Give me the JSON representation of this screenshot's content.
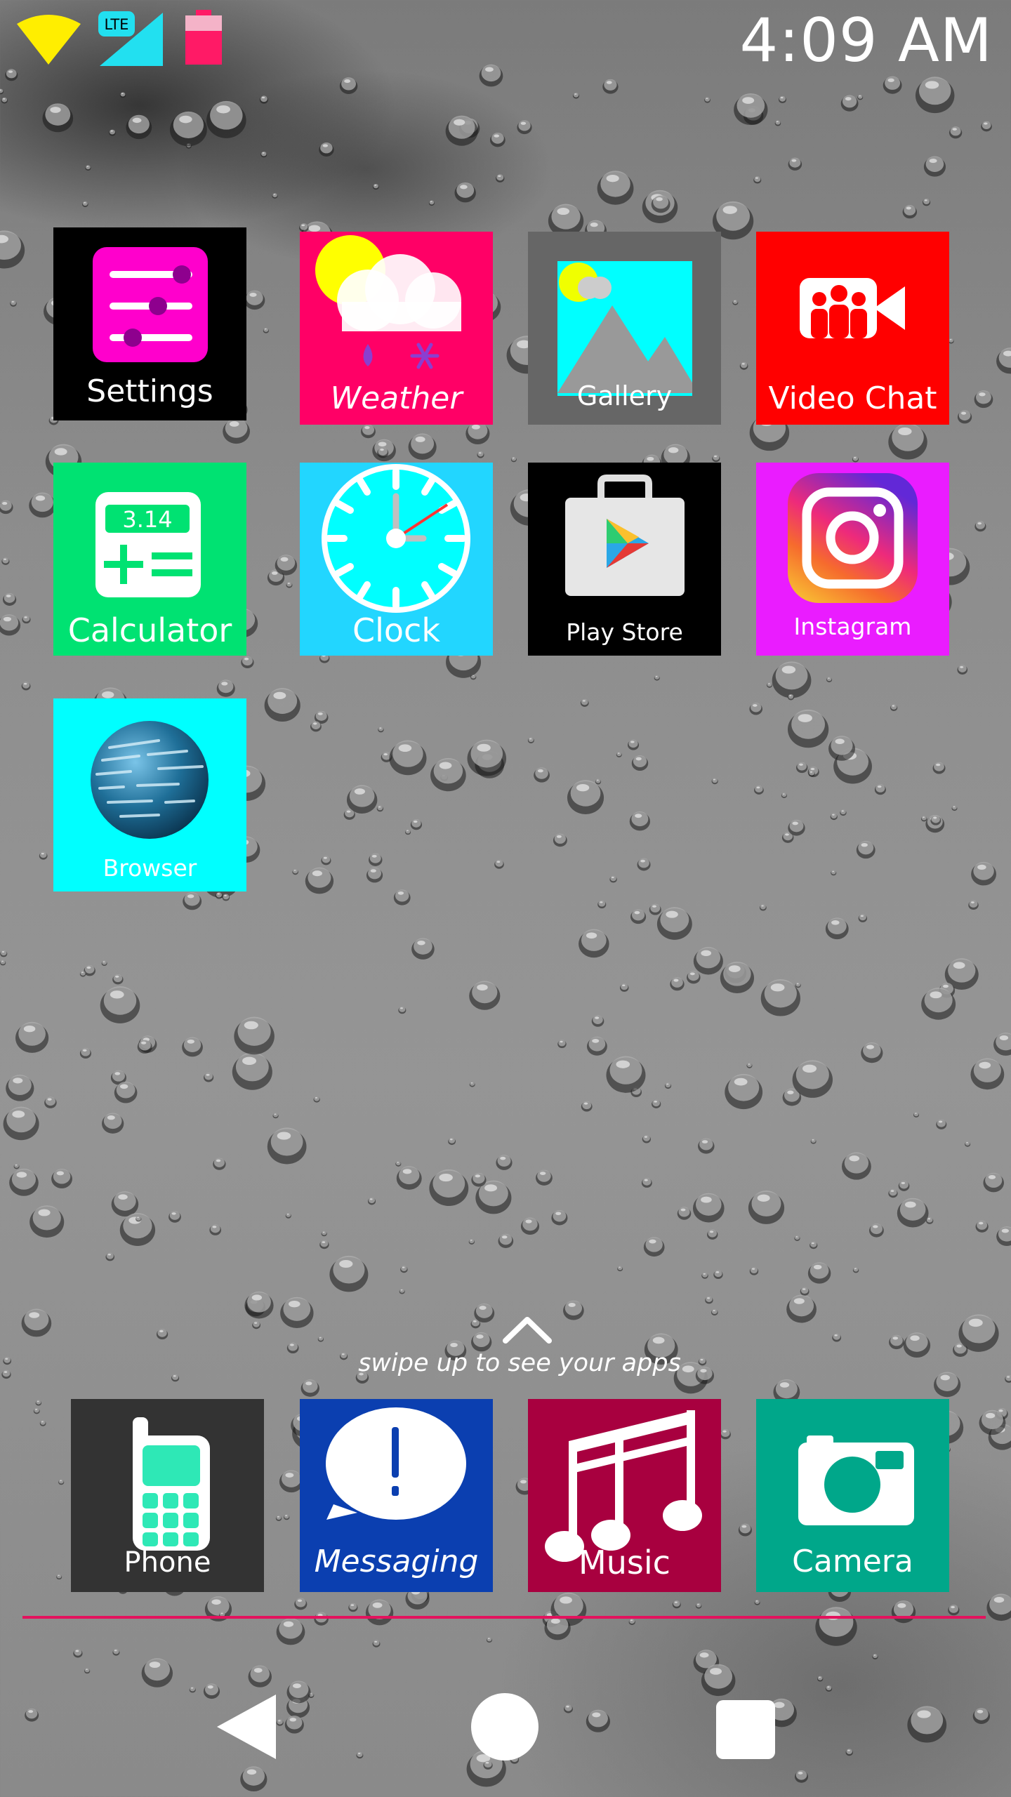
{
  "status_bar": {
    "time": "4:09 AM",
    "network_badge": "LTE",
    "icons": [
      "wifi-icon",
      "cellular-signal-icon",
      "battery-icon"
    ],
    "colors": {
      "wifi": "#ffee00",
      "signal": "#22e0f0",
      "battery": "#ff1a66"
    }
  },
  "apps": [
    {
      "label": "Settings",
      "icon": "settings-icon",
      "bg": "#000000"
    },
    {
      "label": "Weather",
      "icon": "weather-icon",
      "bg": "#ff0066"
    },
    {
      "label": "Gallery",
      "icon": "gallery-icon",
      "bg": "#666666"
    },
    {
      "label": "Video Chat",
      "icon": "video-chat-icon",
      "bg": "#ff0000"
    },
    {
      "label": "Calculator",
      "icon": "calculator-icon",
      "bg": "#00e272",
      "display": "3.14"
    },
    {
      "label": "Clock",
      "icon": "clock-icon",
      "bg": "#22d6ff"
    },
    {
      "label": "Play Store",
      "icon": "play-store-icon",
      "bg": "#000000"
    },
    {
      "label": "Instagram",
      "icon": "instagram-icon",
      "bg": "#ea1cff"
    },
    {
      "label": "Browser",
      "icon": "globe-icon",
      "bg": "#00ffff"
    }
  ],
  "swipe_hint": {
    "text": "swipe up to see your apps",
    "icon": "chevron-up-icon"
  },
  "dock": [
    {
      "label": "Phone",
      "icon": "phone-icon",
      "bg": "#333333"
    },
    {
      "label": "Messaging",
      "icon": "messaging-icon",
      "bg": "#0b3fb0"
    },
    {
      "label": "Music",
      "icon": "music-icon",
      "bg": "#a8003f"
    },
    {
      "label": "Camera",
      "icon": "camera-icon",
      "bg": "#00a78a"
    }
  ],
  "divider_color": "#e3125d",
  "nav": {
    "icons": [
      "back-icon",
      "home-icon",
      "recents-icon"
    ]
  }
}
